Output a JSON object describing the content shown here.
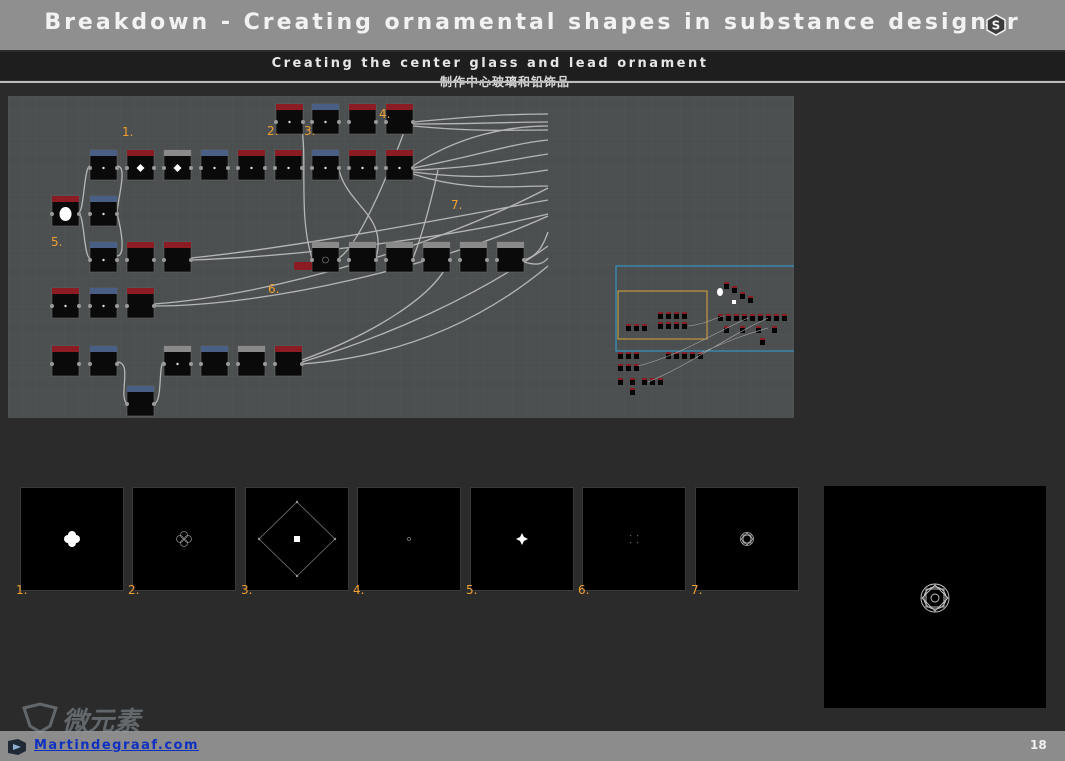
{
  "header": {
    "title": "Breakdown - Creating ornamental shapes in substance designer",
    "logo_icon": "substance-designer-icon"
  },
  "subheader": {
    "title_en": "Creating the center glass and lead ornament",
    "title_cn": "制作中心玻璃和铅饰品"
  },
  "graph": {
    "step_labels": [
      "1.",
      "2.",
      "3.",
      "4.",
      "5.",
      "6.",
      "7."
    ],
    "colors": {
      "canvas": "#4c4f50",
      "grid": "#575a5b",
      "node_body": "#0a0a0a",
      "header_red": "#8b1c24",
      "header_blue": "#4a5f86",
      "header_gray": "#8a8a8a",
      "wire": "#c8c8c8",
      "overview_frame": "#2ea3d8",
      "overview_zoom": "#d9a43a"
    }
  },
  "thumbnails": {
    "labels": [
      "1.",
      "2.",
      "3.",
      "4.",
      "5.",
      "6.",
      "7."
    ]
  },
  "footer": {
    "link_text": "Martindegraaf.com",
    "page_number": "18",
    "watermark_text": "微元素"
  }
}
